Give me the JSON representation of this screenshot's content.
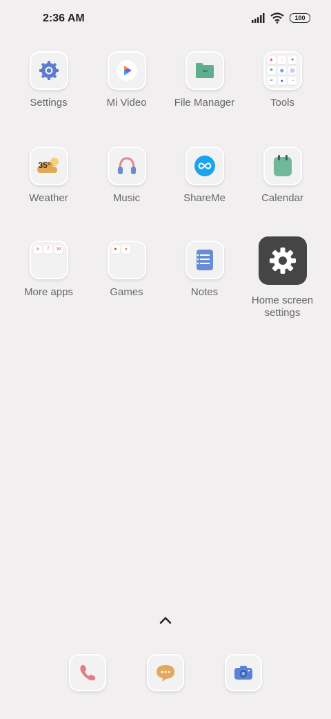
{
  "status_bar": {
    "time": "2:36 AM",
    "battery": "100",
    "icons": [
      "signal-icon",
      "wifi-icon",
      "battery-icon"
    ]
  },
  "apps": [
    {
      "label": "Settings",
      "icon": "gear-icon"
    },
    {
      "label": "Mi Video",
      "icon": "play-icon"
    },
    {
      "label": "File Manager",
      "icon": "folder-icon"
    },
    {
      "label": "Tools",
      "icon": "folder-grid-icon"
    },
    {
      "label": "Weather",
      "icon": "weather-icon",
      "badge": "35°"
    },
    {
      "label": "Music",
      "icon": "headphones-icon"
    },
    {
      "label": "ShareMe",
      "icon": "infinity-icon"
    },
    {
      "label": "Calendar",
      "icon": "calendar-icon"
    },
    {
      "label": "More apps",
      "icon": "folder-grid-icon",
      "mini": [
        "a",
        "f",
        "W"
      ]
    },
    {
      "label": "Games",
      "icon": "folder-grid-icon"
    },
    {
      "label": "Notes",
      "icon": "notes-icon"
    },
    {
      "label": "Home screen settings",
      "icon": "gear-icon"
    }
  ],
  "dock": [
    {
      "name": "phone",
      "icon": "phone-icon"
    },
    {
      "name": "messages",
      "icon": "message-icon"
    },
    {
      "name": "camera",
      "icon": "camera-icon"
    }
  ],
  "drawer": {
    "icon": "chevron-up-icon"
  },
  "colors": {
    "background": "#f1eff0",
    "settings_blue": "#5b7bd0",
    "file_green": "#5fae8f",
    "weather_orange": "#e0a955",
    "music_pink": "#e28a8a",
    "shareme_blue": "#1aa3ee",
    "calendar_green": "#6fb89a",
    "notes_blue": "#6a8bd6",
    "dock_phone": "#e27b84",
    "dock_msg": "#e3a85b",
    "dock_camera": "#5a82d6"
  }
}
